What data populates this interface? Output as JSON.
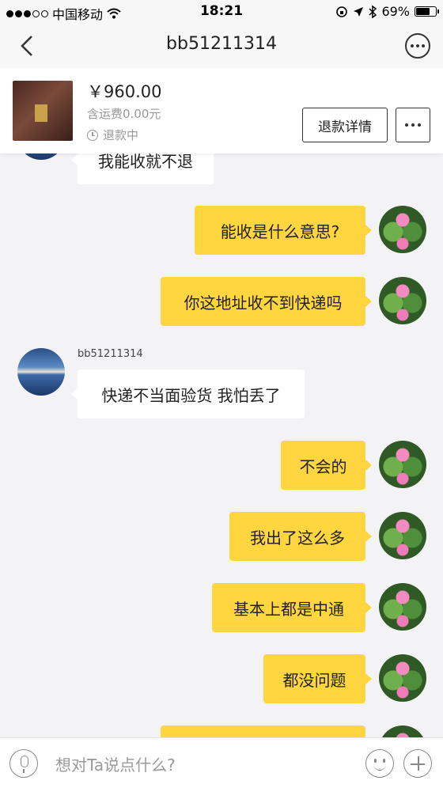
{
  "status_bar": {
    "carrier": "中国移动",
    "time": "18:21",
    "battery": "69%",
    "battery_level": 0.69
  },
  "nav": {
    "title": "bb51211314"
  },
  "product": {
    "price": "￥960.00",
    "shipping": "含运费0.00元",
    "status": "退款中",
    "refund_button": "退款详情"
  },
  "messages": [
    {
      "side": "in",
      "text": "我能收就不退"
    },
    {
      "side": "out",
      "text": "能收是什么意思?"
    },
    {
      "side": "out",
      "text": "你这地址收不到快递吗"
    },
    {
      "side": "in",
      "sender": "bb51211314",
      "text": "快递不当面验货 我怕丢了"
    },
    {
      "side": "out",
      "text": "不会的"
    },
    {
      "side": "out",
      "text": "我出了这么多"
    },
    {
      "side": "out",
      "text": "基本上都是中通"
    },
    {
      "side": "out",
      "text": "都没问题"
    },
    {
      "side": "out",
      "text": ""
    }
  ],
  "input": {
    "placeholder": "想对Ta说点什么?"
  }
}
